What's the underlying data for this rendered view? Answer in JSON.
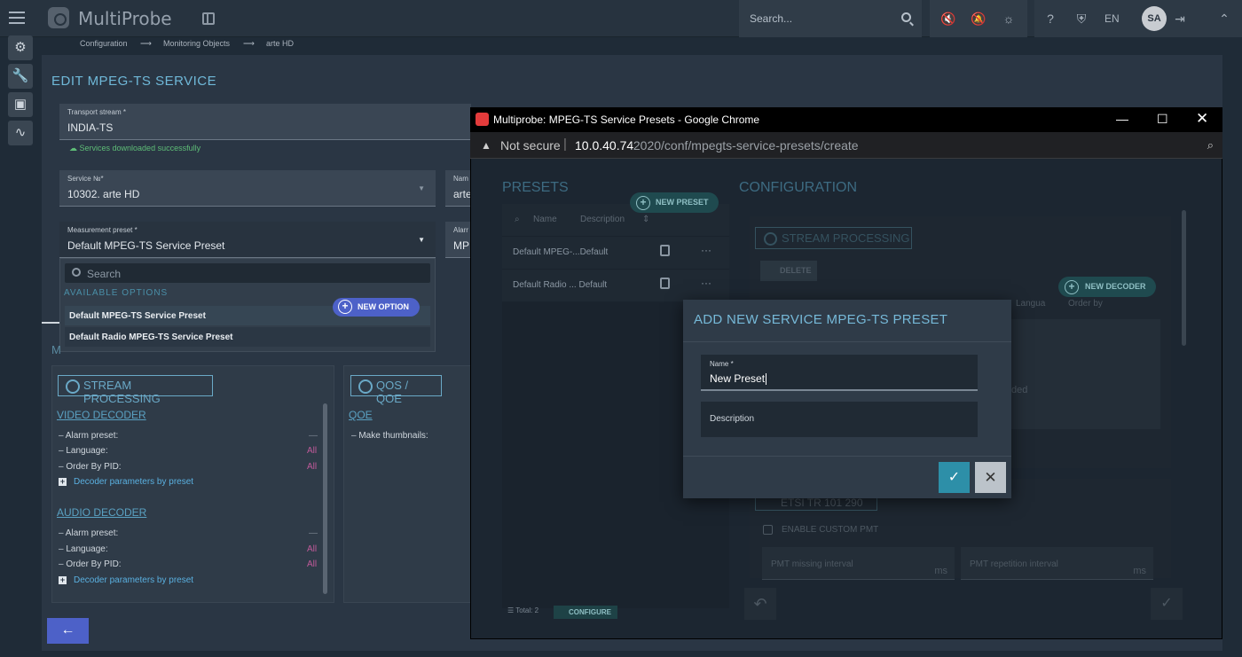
{
  "app": {
    "brand": "MultiProbe"
  },
  "topbar": {
    "search_placeholder": "Search...",
    "lang": "EN",
    "avatar_initials": "SA"
  },
  "breadcrumb": [
    "Configuration",
    "Monitoring Objects",
    "arte HD"
  ],
  "page": {
    "title": "EDIT MPEG-TS SERVICE",
    "transport_stream": {
      "label": "Transport stream *",
      "value": "INDIA-TS",
      "status": "Services downloaded successfully"
    },
    "service_no": {
      "label": "Service №*",
      "value": "10302. arte HD"
    },
    "name_field": {
      "label": "Nam",
      "value": "arte"
    },
    "measurement_preset": {
      "label": "Measurement preset *",
      "value": "Default MPEG-TS Service Preset"
    },
    "alarm_field": {
      "label": "Alarr",
      "value": "MPI"
    },
    "dropdown": {
      "search_placeholder": "Search",
      "section_label": "AVAILABLE OPTIONS",
      "new_option_label": "NEW OPTION",
      "options": [
        "Default MPEG-TS Service Preset",
        "Default Radio MPEG-TS Service Preset"
      ]
    },
    "hidden_heading_fragment": "M",
    "stream_processing": {
      "title": "STREAM PROCESSING",
      "video": {
        "title": "VIDEO DECODER",
        "rows": [
          {
            "label": "Alarm preset:",
            "value": "—"
          },
          {
            "label": "Language:",
            "value": "All"
          },
          {
            "label": "Order By PID:",
            "value": "All"
          }
        ],
        "params_link": "Decoder parameters by preset"
      },
      "audio": {
        "title": "AUDIO DECODER",
        "rows": [
          {
            "label": "Alarm preset:",
            "value": "—"
          },
          {
            "label": "Language:",
            "value": "All"
          },
          {
            "label": "Order By PID:",
            "value": "All"
          }
        ],
        "params_link": "Decoder parameters by preset"
      }
    },
    "qos": {
      "title": "QOS / QOE",
      "qoe_title": "QOE",
      "thumbnails_label": "Make thumbnails:"
    }
  },
  "chrome": {
    "window_title": "Multiprobe: MPEG-TS Service Presets - Google Chrome",
    "not_secure": "Not secure",
    "url_host": "10.0.40.74",
    "url_path": ":2020/conf/mpegts-service-presets/create",
    "presets": {
      "title": "PRESETS",
      "new_preset_label": "NEW PRESET",
      "col_name": "Name",
      "col_description": "Description",
      "rows": [
        {
          "name": "Default MPEG-...Default"
        },
        {
          "name": "Default Radio ... Default"
        }
      ],
      "total": "Total: 2",
      "configure_label": "CONFIGURE"
    },
    "configuration": {
      "title": "CONFIGURATION",
      "stream_processing": "STREAM PROCESSING",
      "delete_label": "DELETE",
      "new_decoder_label": "NEW DECODER",
      "col_language": "Langua",
      "col_order": "Order by",
      "empty_fragment": "ded",
      "etsi_fragment": "ETSI TR 101 290",
      "enable_custom_pmt": "ENABLE CUSTOM PMT",
      "pmt_missing": "PMT missing interval",
      "pmt_repetition": "PMT repetition interval",
      "unit": "ms"
    },
    "modal": {
      "title": "ADD NEW SERVICE MPEG-TS PRESET",
      "name_label": "Name *",
      "name_value": "New Preset",
      "description_label": "Description"
    }
  }
}
